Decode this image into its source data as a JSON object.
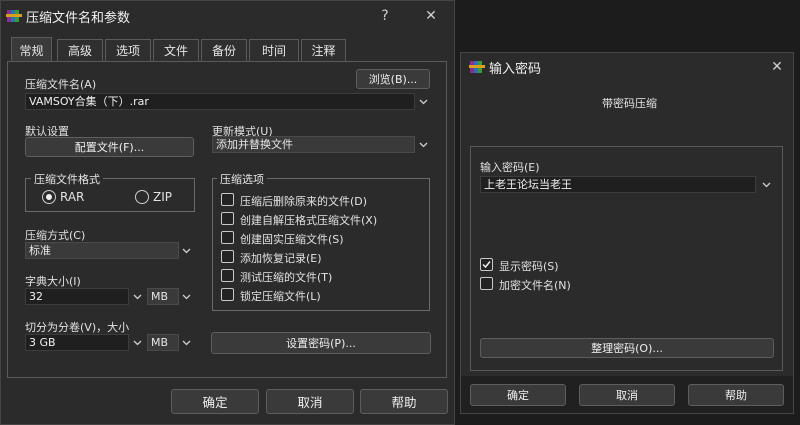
{
  "main": {
    "title": "压缩文件名和参数",
    "help_glyph": "?",
    "close_glyph": "✕",
    "tabs": [
      "常规",
      "高级",
      "选项",
      "文件",
      "备份",
      "时间",
      "注释"
    ],
    "archive_name_label": "压缩文件名(A)",
    "archive_name_value": "VAMSOY合集（下）.rar",
    "browse_label": "浏览(B)...",
    "default_settings_label": "默认设置",
    "profiles_label": "配置文件(F)...",
    "update_mode_label": "更新模式(U)",
    "update_mode_value": "添加并替换文件",
    "format_group_label": "压缩文件格式",
    "format_rar": "RAR",
    "format_zip": "ZIP",
    "method_label": "压缩方式(C)",
    "method_value": "标准",
    "dict_label": "字典大小(I)",
    "dict_value": "32",
    "dict_unit": "MB",
    "split_label": "切分为分卷(V)，大小",
    "split_value": "3 GB",
    "split_unit": "MB",
    "options_group_label": "压缩选项",
    "options": [
      {
        "label": "压缩后删除原来的文件(D)",
        "checked": false
      },
      {
        "label": "创建自解压格式压缩文件(X)",
        "checked": false
      },
      {
        "label": "创建固实压缩文件(S)",
        "checked": false
      },
      {
        "label": "添加恢复记录(E)",
        "checked": false
      },
      {
        "label": "测试压缩的文件(T)",
        "checked": false
      },
      {
        "label": "锁定压缩文件(L)",
        "checked": false
      }
    ],
    "set_password_label": "设置密码(P)...",
    "ok_label": "确定",
    "cancel_label": "取消",
    "help_label": "帮助"
  },
  "password_dialog": {
    "title": "输入密码",
    "close_glyph": "✕",
    "subtitle": "带密码压缩",
    "password_label": "输入密码(E)",
    "password_value": "上老王论坛当老王",
    "show_password_label": "显示密码(S)",
    "show_password_checked": true,
    "encrypt_names_label": "加密文件名(N)",
    "encrypt_names_checked": false,
    "organize_label": "整理密码(O)...",
    "ok_label": "确定",
    "cancel_label": "取消",
    "help_label": "帮助"
  },
  "colors": {
    "background": "#1c1c1c",
    "window": "#2b2b2b",
    "field": "#1f1f1f",
    "button": "#3a3a3a"
  },
  "icons": {
    "app": "winrar-books-icon",
    "help": "question-mark-icon",
    "close": "close-icon",
    "dropdown": "chevron-down-icon",
    "check": "checkmark-icon"
  }
}
